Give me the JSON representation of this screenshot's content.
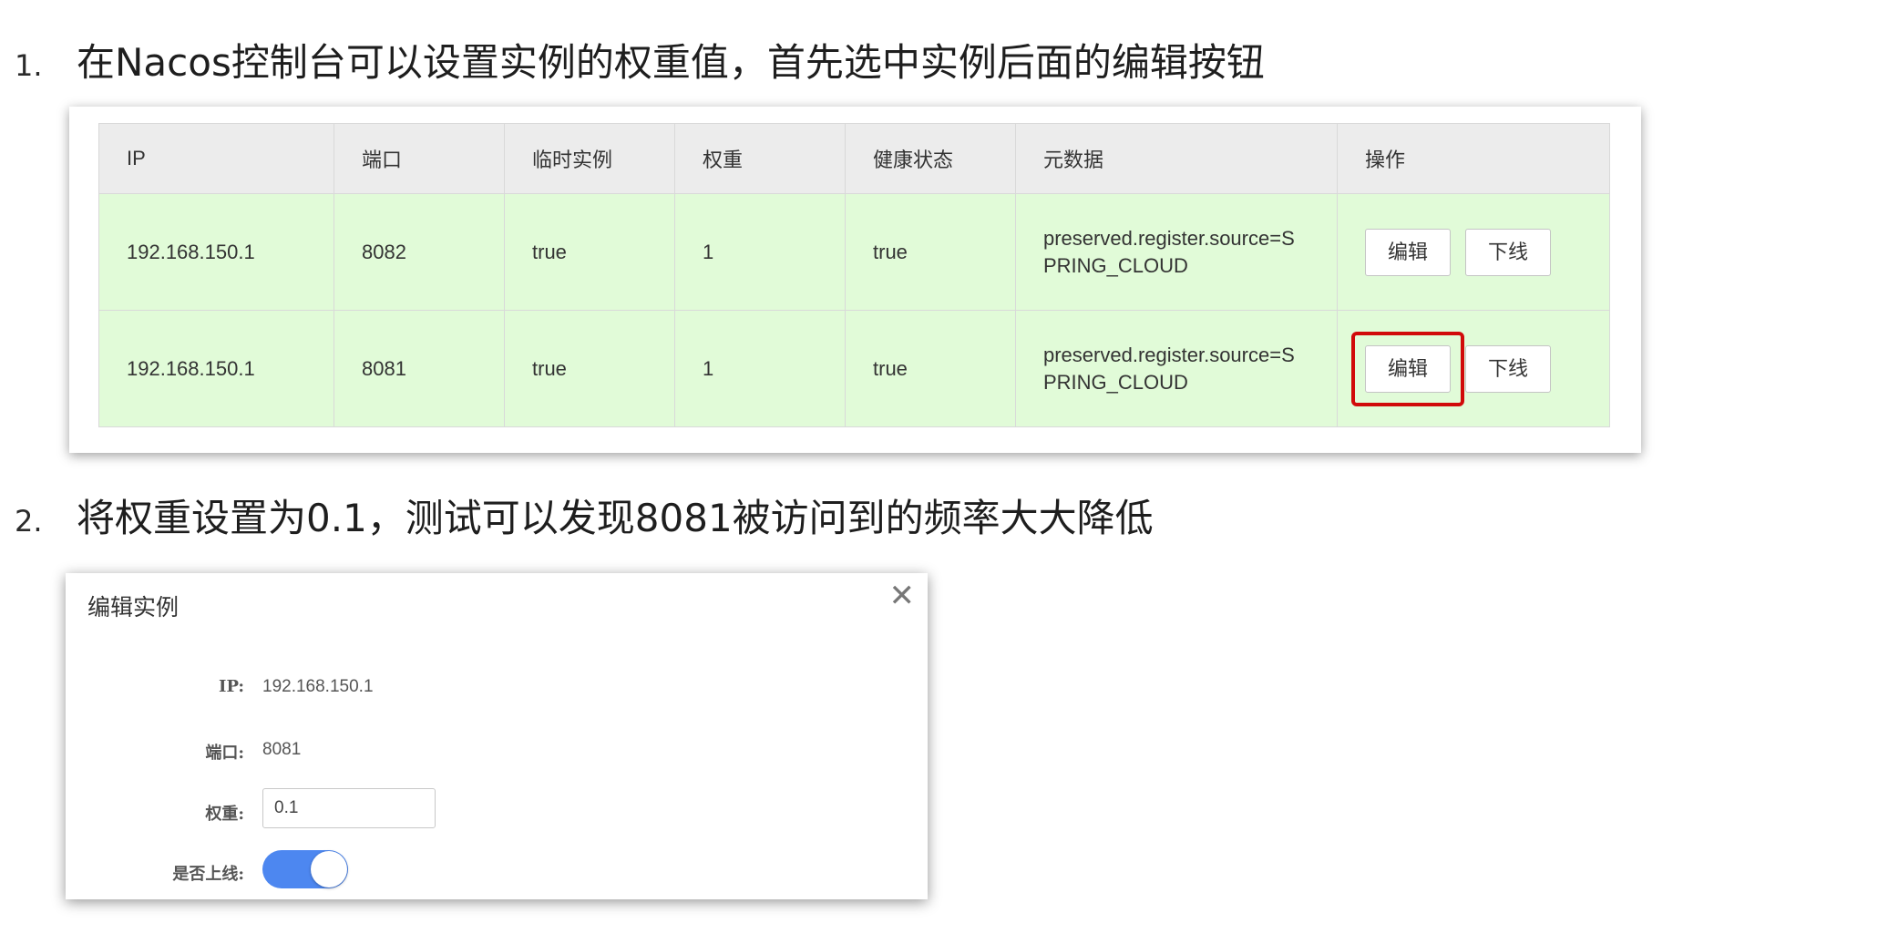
{
  "step1": {
    "number": "1.",
    "text": "在Nacos控制台可以设置实例的权重值，首先选中实例后面的编辑按钮"
  },
  "step2": {
    "number": "2.",
    "text": "将权重设置为0.1，测试可以发现8081被访问到的频率大大降低"
  },
  "instance_table": {
    "headers": [
      "IP",
      "端口",
      "临时实例",
      "权重",
      "健康状态",
      "元数据",
      "操作"
    ],
    "rows": [
      {
        "ip": "192.168.150.1",
        "port": "8082",
        "ephemeral": "true",
        "weight": "1",
        "healthy": "true",
        "metadata_line1": "preserved.register.source=S",
        "metadata_line2": "PRING_CLOUD",
        "edit_label": "编辑",
        "offline_label": "下线"
      },
      {
        "ip": "192.168.150.1",
        "port": "8081",
        "ephemeral": "true",
        "weight": "1",
        "healthy": "true",
        "metadata_line1": "preserved.register.source=S",
        "metadata_line2": "PRING_CLOUD",
        "edit_label": "编辑",
        "offline_label": "下线"
      }
    ],
    "highlight_color": "#d10a0a",
    "row_color": "#e1fbd8"
  },
  "edit_dialog": {
    "title": "编辑实例",
    "close_icon": "close-icon",
    "ip_label": "IP:",
    "ip_value": "192.168.150.1",
    "port_label": "端口:",
    "port_value": "8081",
    "weight_label": "权重:",
    "weight_value": "0.1",
    "online_label": "是否上线:",
    "online_enabled": true,
    "switch_color": "#4d87f0"
  }
}
